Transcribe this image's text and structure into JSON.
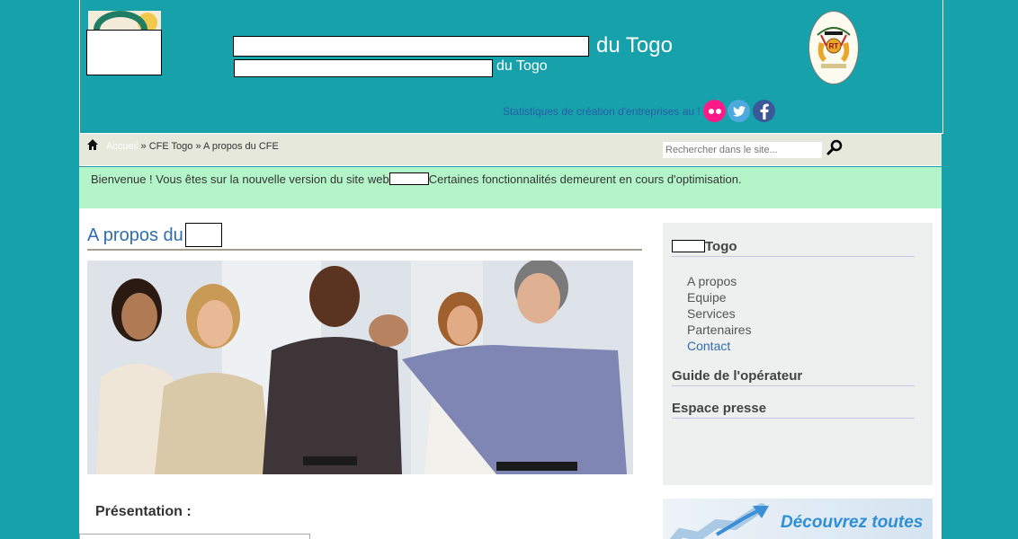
{
  "header": {
    "title_suffix": "du Togo",
    "subtitle_suffix": "du Togo",
    "stats_link": "Statistiques de création d'entreprises au !"
  },
  "social": [
    "flickr-icon",
    "twitter-icon",
    "facebook-icon"
  ],
  "breadcrumb": {
    "home": "Accueil",
    "sep1": " » ",
    "middle": "CFE Togo",
    "sep2": " » ",
    "current": "A propos du CFE"
  },
  "search": {
    "placeholder": "Rechercher dans le site..."
  },
  "welcome": {
    "before": "Bienvenue ! Vous êtes sur la nouvelle version du site web",
    "after": "Certaines fonctionnalités demeurent en cours d'optimisation."
  },
  "main": {
    "heading": "A propos du",
    "section_title": "Présentation :"
  },
  "sidebar": {
    "section1_suffix": "Togo",
    "menu": [
      "A propos",
      "Equipe",
      "Services",
      "Partenaires",
      "Contact"
    ],
    "section2": "Guide de l'opérateur",
    "section3": "Espace presse"
  },
  "promo": {
    "text": "Découvrez toutes"
  },
  "colors": {
    "header_bg": "#17a1aa",
    "breadcrumb_bg": "#e5e8da",
    "welcome_bg": "#b4f4c9",
    "heading_color": "#2f6dad",
    "sidebar_bg": "#eeefef"
  }
}
